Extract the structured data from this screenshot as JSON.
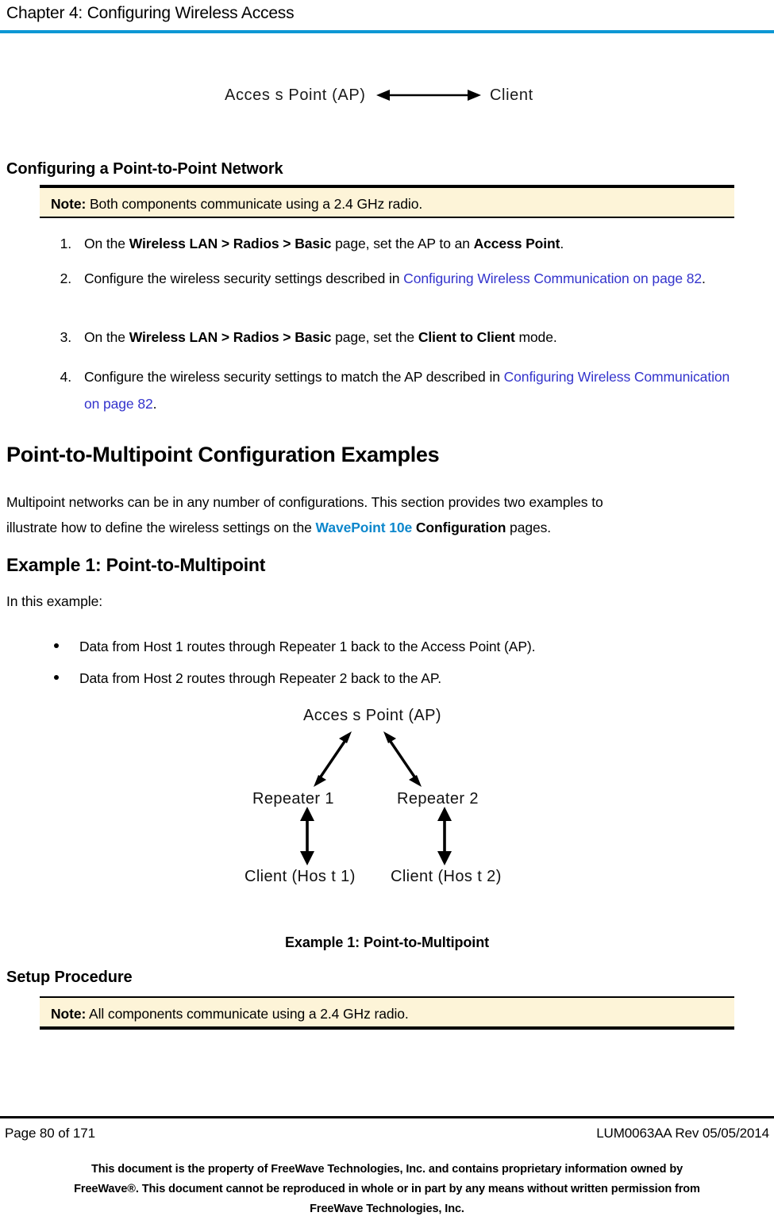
{
  "header": {
    "chapter_title": "Chapter 4: Configuring Wireless Access",
    "rule_color": "#0d97d4"
  },
  "diagram_top": {
    "name": "point-to-point-diagram",
    "left_label": "Acces s  Point (AP)",
    "right_label": "Client",
    "arrow": "double-headed-horizontal-arrow"
  },
  "sections": {
    "p2p_heading": "Configuring a Point-to-Point Network",
    "note_1": {
      "label": "Note:",
      "text": "Both components communicate using a 2.4 GHz radio."
    },
    "steps": [
      {
        "number": "1.",
        "parts": [
          {
            "t": "On the ",
            "style": "normal"
          },
          {
            "t": "Wireless LAN > Radios > Basic",
            "style": "bold"
          },
          {
            "t": " page, set the AP to an ",
            "style": "normal"
          },
          {
            "t": "Access Point",
            "style": "bold"
          },
          {
            "t": ".",
            "style": "normal"
          }
        ]
      },
      {
        "number": "2.",
        "parts": [
          {
            "t": "Configure the wireless security settings described in ",
            "style": "normal"
          },
          {
            "t": "Configuring Wireless Communication on page 82",
            "style": "xref"
          },
          {
            "t": ".",
            "style": "normal"
          }
        ]
      },
      {
        "number": "3.",
        "parts": [
          {
            "t": "On the ",
            "style": "normal"
          },
          {
            "t": "Wireless LAN > Radios > Basic",
            "style": "bold"
          },
          {
            "t": " page, set the ",
            "style": "normal"
          },
          {
            "t": "Client to Client",
            "style": "bold"
          },
          {
            "t": " mode.",
            "style": "normal"
          }
        ]
      },
      {
        "number": "4.",
        "parts": [
          {
            "t": "Configure the wireless security settings to match the AP described in ",
            "style": "normal"
          },
          {
            "t": "Configuring Wireless Communication on page 82",
            "style": "xref"
          },
          {
            "t": ".",
            "style": "normal"
          }
        ]
      }
    ],
    "pmp_heading": "Point-to-Multipoint Configuration Examples",
    "pmp_intro_line1": "Multipoint networks can be in any number of configurations. This section provides two examples to",
    "pmp_intro_line2_a": "illustrate how to define the wireless settings on the ",
    "pmp_intro_product": "WavePoint 10e",
    "pmp_intro_line2_b": " Configuration",
    "pmp_intro_line2_c": " pages.",
    "example1_heading": "Example 1: Point-to-Multipoint",
    "example1_lead": "In this example:",
    "bullets": [
      "Data from Host 1 routes through Repeater 1 back to the Access Point (AP).",
      "Data from Host 2 routes through Repeater 2 back to the AP."
    ],
    "figure_caption": "Example 1: Point-to-Multipoint",
    "setup_heading": "Setup Procedure",
    "note_2": {
      "label": "Note:",
      "text": "All components communicate using a 2.4 GHz radio."
    }
  },
  "diagram_main": {
    "name": "point-to-multipoint-diagram",
    "access_point": "Acces s  Point (AP)",
    "repeater_1": "Repeater 1",
    "repeater_2": "Repeater 2",
    "client_host_1": "Client (Hos t 1)",
    "client_host_2": "Client (Hos t 2)"
  },
  "footer": {
    "page_label": "Page 80 of 171",
    "doc_revision": "LUM0063AA Rev 05/05/2014",
    "legal_line_1": "This document is the property of FreeWave Technologies, Inc. and contains proprietary information owned by",
    "legal_line_2": "FreeWave®. This document cannot be reproduced in whole or in part by any means without written permission from",
    "legal_line_3": "FreeWave Technologies, Inc."
  },
  "colors": {
    "accent_blue": "#0d97d4",
    "link_blue": "#3333cc",
    "product_blue": "#0d87cc",
    "note_background": "#fdf4d8"
  }
}
